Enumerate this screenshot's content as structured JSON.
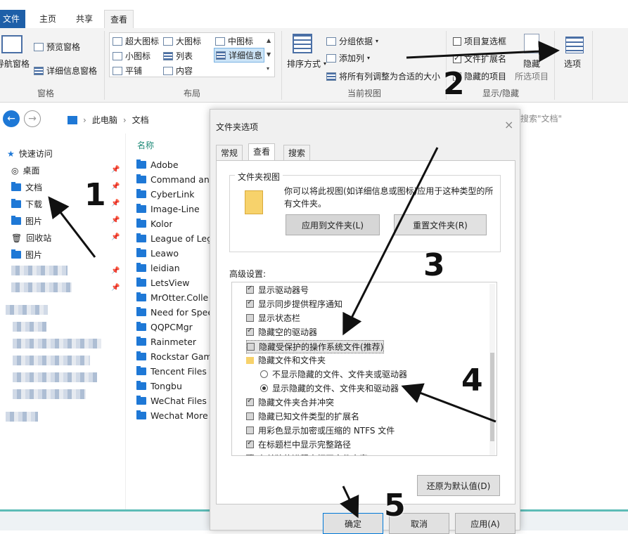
{
  "ribbon": {
    "tabs": [
      "文件",
      "主页",
      "共享",
      "查看"
    ],
    "pane_group": {
      "nav_pane": "导航窗格",
      "preview": "预览窗格",
      "details": "详细信息窗格",
      "label": "窗格"
    },
    "layout_group": {
      "items": [
        "超大图标",
        "大图标",
        "中图标",
        "小图标",
        "列表",
        "详细信息",
        "平铺",
        "内容"
      ],
      "selected": "详细信息",
      "label": "布局"
    },
    "view_group": {
      "sort": "排序方式",
      "group_by": "分组依据",
      "add_col": "添加列",
      "fit_cols": "将所有列调整为合适的大小",
      "label": "当前视图"
    },
    "showhide_group": {
      "item_checkbox": "项目复选框",
      "file_ext": "文件扩展名",
      "hidden_items": "隐藏的项目",
      "hide": "隐藏",
      "hide_sub": "所选项目",
      "label": "显示/隐藏"
    },
    "options": "选项"
  },
  "address": {
    "crumbs": [
      "此电脑",
      "文档"
    ],
    "search_placeholder": "搜索\"文档\""
  },
  "nav": {
    "quick_access": "快速访问",
    "items": [
      "桌面",
      "文档",
      "下载",
      "图片",
      "回收站",
      "图片"
    ]
  },
  "files": {
    "header": "名称",
    "items": [
      "Adobe",
      "Command and",
      "CyberLink",
      "Image-Line",
      "Kolor",
      "League of Leg",
      "Leawo",
      "leidian",
      "LetsView",
      "MrOtter.Colle",
      "Need for Spee",
      "QQPCMgr",
      "Rainmeter",
      "Rockstar Game",
      "Tencent Files",
      "Tongbu",
      "WeChat Files",
      "Wechat More"
    ]
  },
  "dialog": {
    "title": "文件夹选项",
    "tabs": [
      "常规",
      "查看",
      "搜索"
    ],
    "folder_view": {
      "legend": "文件夹视图",
      "desc": "你可以将此视图(如详细信息或图标)应用于这种类型的所有文件夹。",
      "apply": "应用到文件夹(L)",
      "reset": "重置文件夹(R)"
    },
    "advanced_label": "高级设置:",
    "advanced": [
      {
        "type": "check",
        "checked": true,
        "label": "显示驱动器号"
      },
      {
        "type": "check",
        "checked": true,
        "label": "显示同步提供程序通知"
      },
      {
        "type": "check",
        "checked": false,
        "label": "显示状态栏"
      },
      {
        "type": "check",
        "checked": true,
        "label": "隐藏空的驱动器"
      },
      {
        "type": "check",
        "checked": false,
        "label": "隐藏受保护的操作系统文件(推荐)"
      },
      {
        "type": "folder",
        "label": "隐藏文件和文件夹"
      },
      {
        "type": "radio",
        "checked": false,
        "label": "不显示隐藏的文件、文件夹或驱动器"
      },
      {
        "type": "radio",
        "checked": true,
        "label": "显示隐藏的文件、文件夹和驱动器"
      },
      {
        "type": "check",
        "checked": true,
        "label": "隐藏文件夹合并冲突"
      },
      {
        "type": "check",
        "checked": false,
        "label": "隐藏已知文件类型的扩展名"
      },
      {
        "type": "check",
        "checked": false,
        "label": "用彩色显示加密或压缩的 NTFS 文件"
      },
      {
        "type": "check",
        "checked": true,
        "label": "在标题栏中显示完整路径"
      },
      {
        "type": "check",
        "checked": true,
        "label": "在单独的进程中打开文件夹窗口"
      }
    ],
    "restore": "还原为默认值(D)",
    "ok": "确定",
    "cancel": "取消",
    "apply": "应用(A)"
  },
  "annotations": [
    "1",
    "2",
    "3",
    "4",
    "5"
  ]
}
